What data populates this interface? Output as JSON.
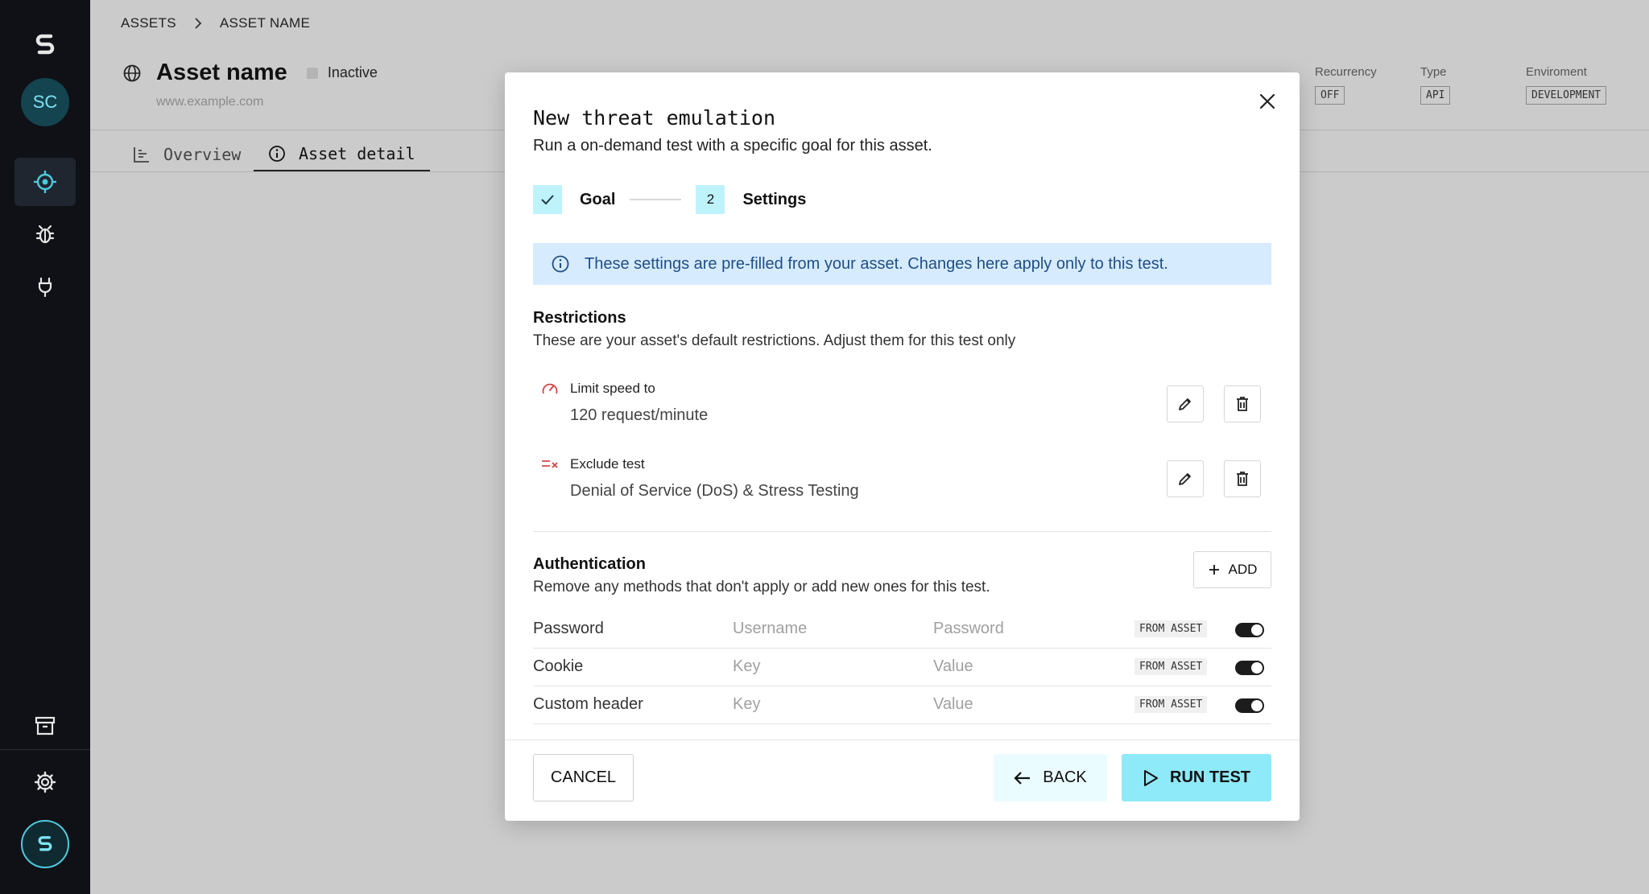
{
  "breadcrumb": {
    "items": [
      "ASSETS",
      "ASSET NAME"
    ]
  },
  "sidebar": {
    "avatar_initials": "SC",
    "icons": [
      "brand-logo-icon",
      "target-icon",
      "bug-icon",
      "plug-icon",
      "archive-icon",
      "gear-icon",
      "brand-logo-icon"
    ],
    "active_index": 0
  },
  "asset": {
    "name": "Asset name",
    "status": "Inactive",
    "url": "www.example.com",
    "meta": [
      {
        "label": "Recurrency",
        "value": "OFF"
      },
      {
        "label": "Type",
        "value": "API"
      },
      {
        "label": "Enviroment",
        "value": "DEVELOPMENT"
      }
    ]
  },
  "tabs": [
    {
      "label": "Overview",
      "icon": "bar-chart-icon",
      "active": false
    },
    {
      "label": "Asset detail",
      "icon": "info-icon",
      "active": true
    }
  ],
  "modal": {
    "title": "New threat emulation",
    "subtitle": "Run a on-demand test with a specific goal for this asset.",
    "steps": [
      {
        "label": "Goal",
        "state": "done"
      },
      {
        "number": "2",
        "label": "Settings",
        "state": "current"
      }
    ],
    "info_banner": "These settings are pre-filled from your asset. Changes here apply only to this test.",
    "restrictions": {
      "title": "Restrictions",
      "subtitle": "These are your asset's default restrictions. Adjust them for this test only",
      "items": [
        {
          "label": "Limit speed to",
          "value": "120 request/minute",
          "icon": "speedometer-icon"
        },
        {
          "label": "Exclude test",
          "value": "Denial of Service (DoS) & Stress Testing",
          "icon": "exclude-list-icon"
        }
      ]
    },
    "authentication": {
      "title": "Authentication",
      "subtitle": "Remove any methods that don't apply or add new ones for this test.",
      "add_label": "ADD",
      "rows": [
        {
          "method": "Password",
          "field1": "Username",
          "field2": "Password",
          "badge": "FROM ASSET",
          "enabled": true
        },
        {
          "method": "Cookie",
          "field1": "Key",
          "field2": "Value",
          "badge": "FROM ASSET",
          "enabled": true
        },
        {
          "method": "Custom header",
          "field1": "Key",
          "field2": "Value",
          "badge": "FROM ASSET",
          "enabled": true
        }
      ]
    },
    "footer": {
      "cancel": "CANCEL",
      "back": "BACK",
      "run": "RUN TEST"
    }
  },
  "colors": {
    "accent": "#8ee9f8",
    "step_bg": "#bff3fb",
    "info_bg": "#d7ebff",
    "info_text": "#1f4f86",
    "danger": "#d64545",
    "sidebar_bg": "#0f1116"
  }
}
